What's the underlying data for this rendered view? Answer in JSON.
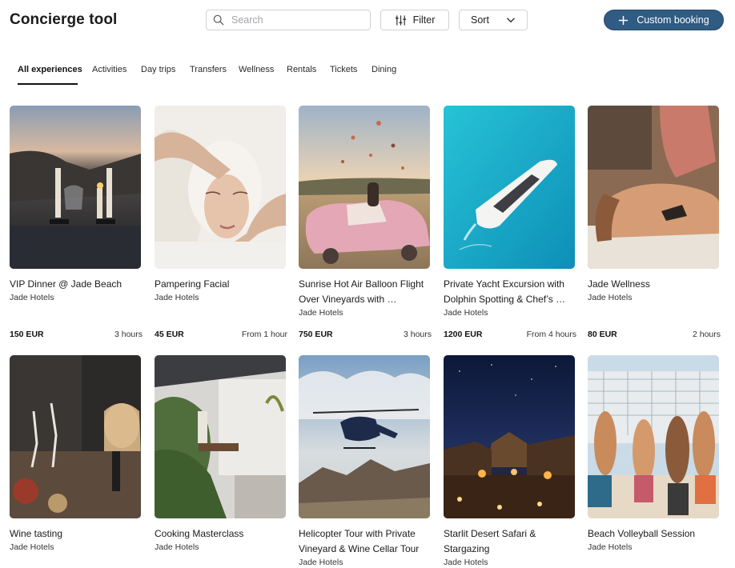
{
  "header": {
    "title": "Concierge tool",
    "search_placeholder": "Search",
    "filter_label": "Filter",
    "sort_label": "Sort",
    "custom_booking_label": "Custom booking",
    "accent_color": "#305b82"
  },
  "tabs": [
    {
      "label": "All experiences",
      "active": true
    },
    {
      "label": "Activities"
    },
    {
      "label": "Day trips"
    },
    {
      "label": "Transfers"
    },
    {
      "label": "Wellness"
    },
    {
      "label": "Rentals"
    },
    {
      "label": "Tickets"
    },
    {
      "label": "Dining"
    }
  ],
  "experiences": [
    {
      "title": "VIP Dinner @ Jade Beach",
      "provider": "Jade Hotels",
      "price": "150 EUR",
      "duration": "3 hours"
    },
    {
      "title": "Pampering Facial",
      "provider": "Jade Hotels",
      "price": "45 EUR",
      "duration": "From 1 hour"
    },
    {
      "title": "Sunrise Hot Air Balloon Flight Over Vineyards with …",
      "provider": "Jade Hotels",
      "price": "750 EUR",
      "duration": "3 hours"
    },
    {
      "title": "Private Yacht Excursion with Dolphin Spotting & Chef’s …",
      "provider": "Jade Hotels",
      "price": "1200 EUR",
      "duration": "From 4 hours"
    },
    {
      "title": "Jade Wellness",
      "provider": "Jade Hotels",
      "price": "80 EUR",
      "duration": "2 hours"
    },
    {
      "title": "Wine tasting",
      "provider": "Jade Hotels"
    },
    {
      "title": "Cooking Masterclass",
      "provider": "Jade Hotels"
    },
    {
      "title": "Helicopter Tour with Private Vineyard & Wine Cellar Tour",
      "provider": "Jade Hotels"
    },
    {
      "title": "Starlit Desert Safari & Stargazing",
      "provider": "Jade Hotels"
    },
    {
      "title": "Beach Volleyball Session",
      "provider": "Jade Hotels"
    }
  ]
}
